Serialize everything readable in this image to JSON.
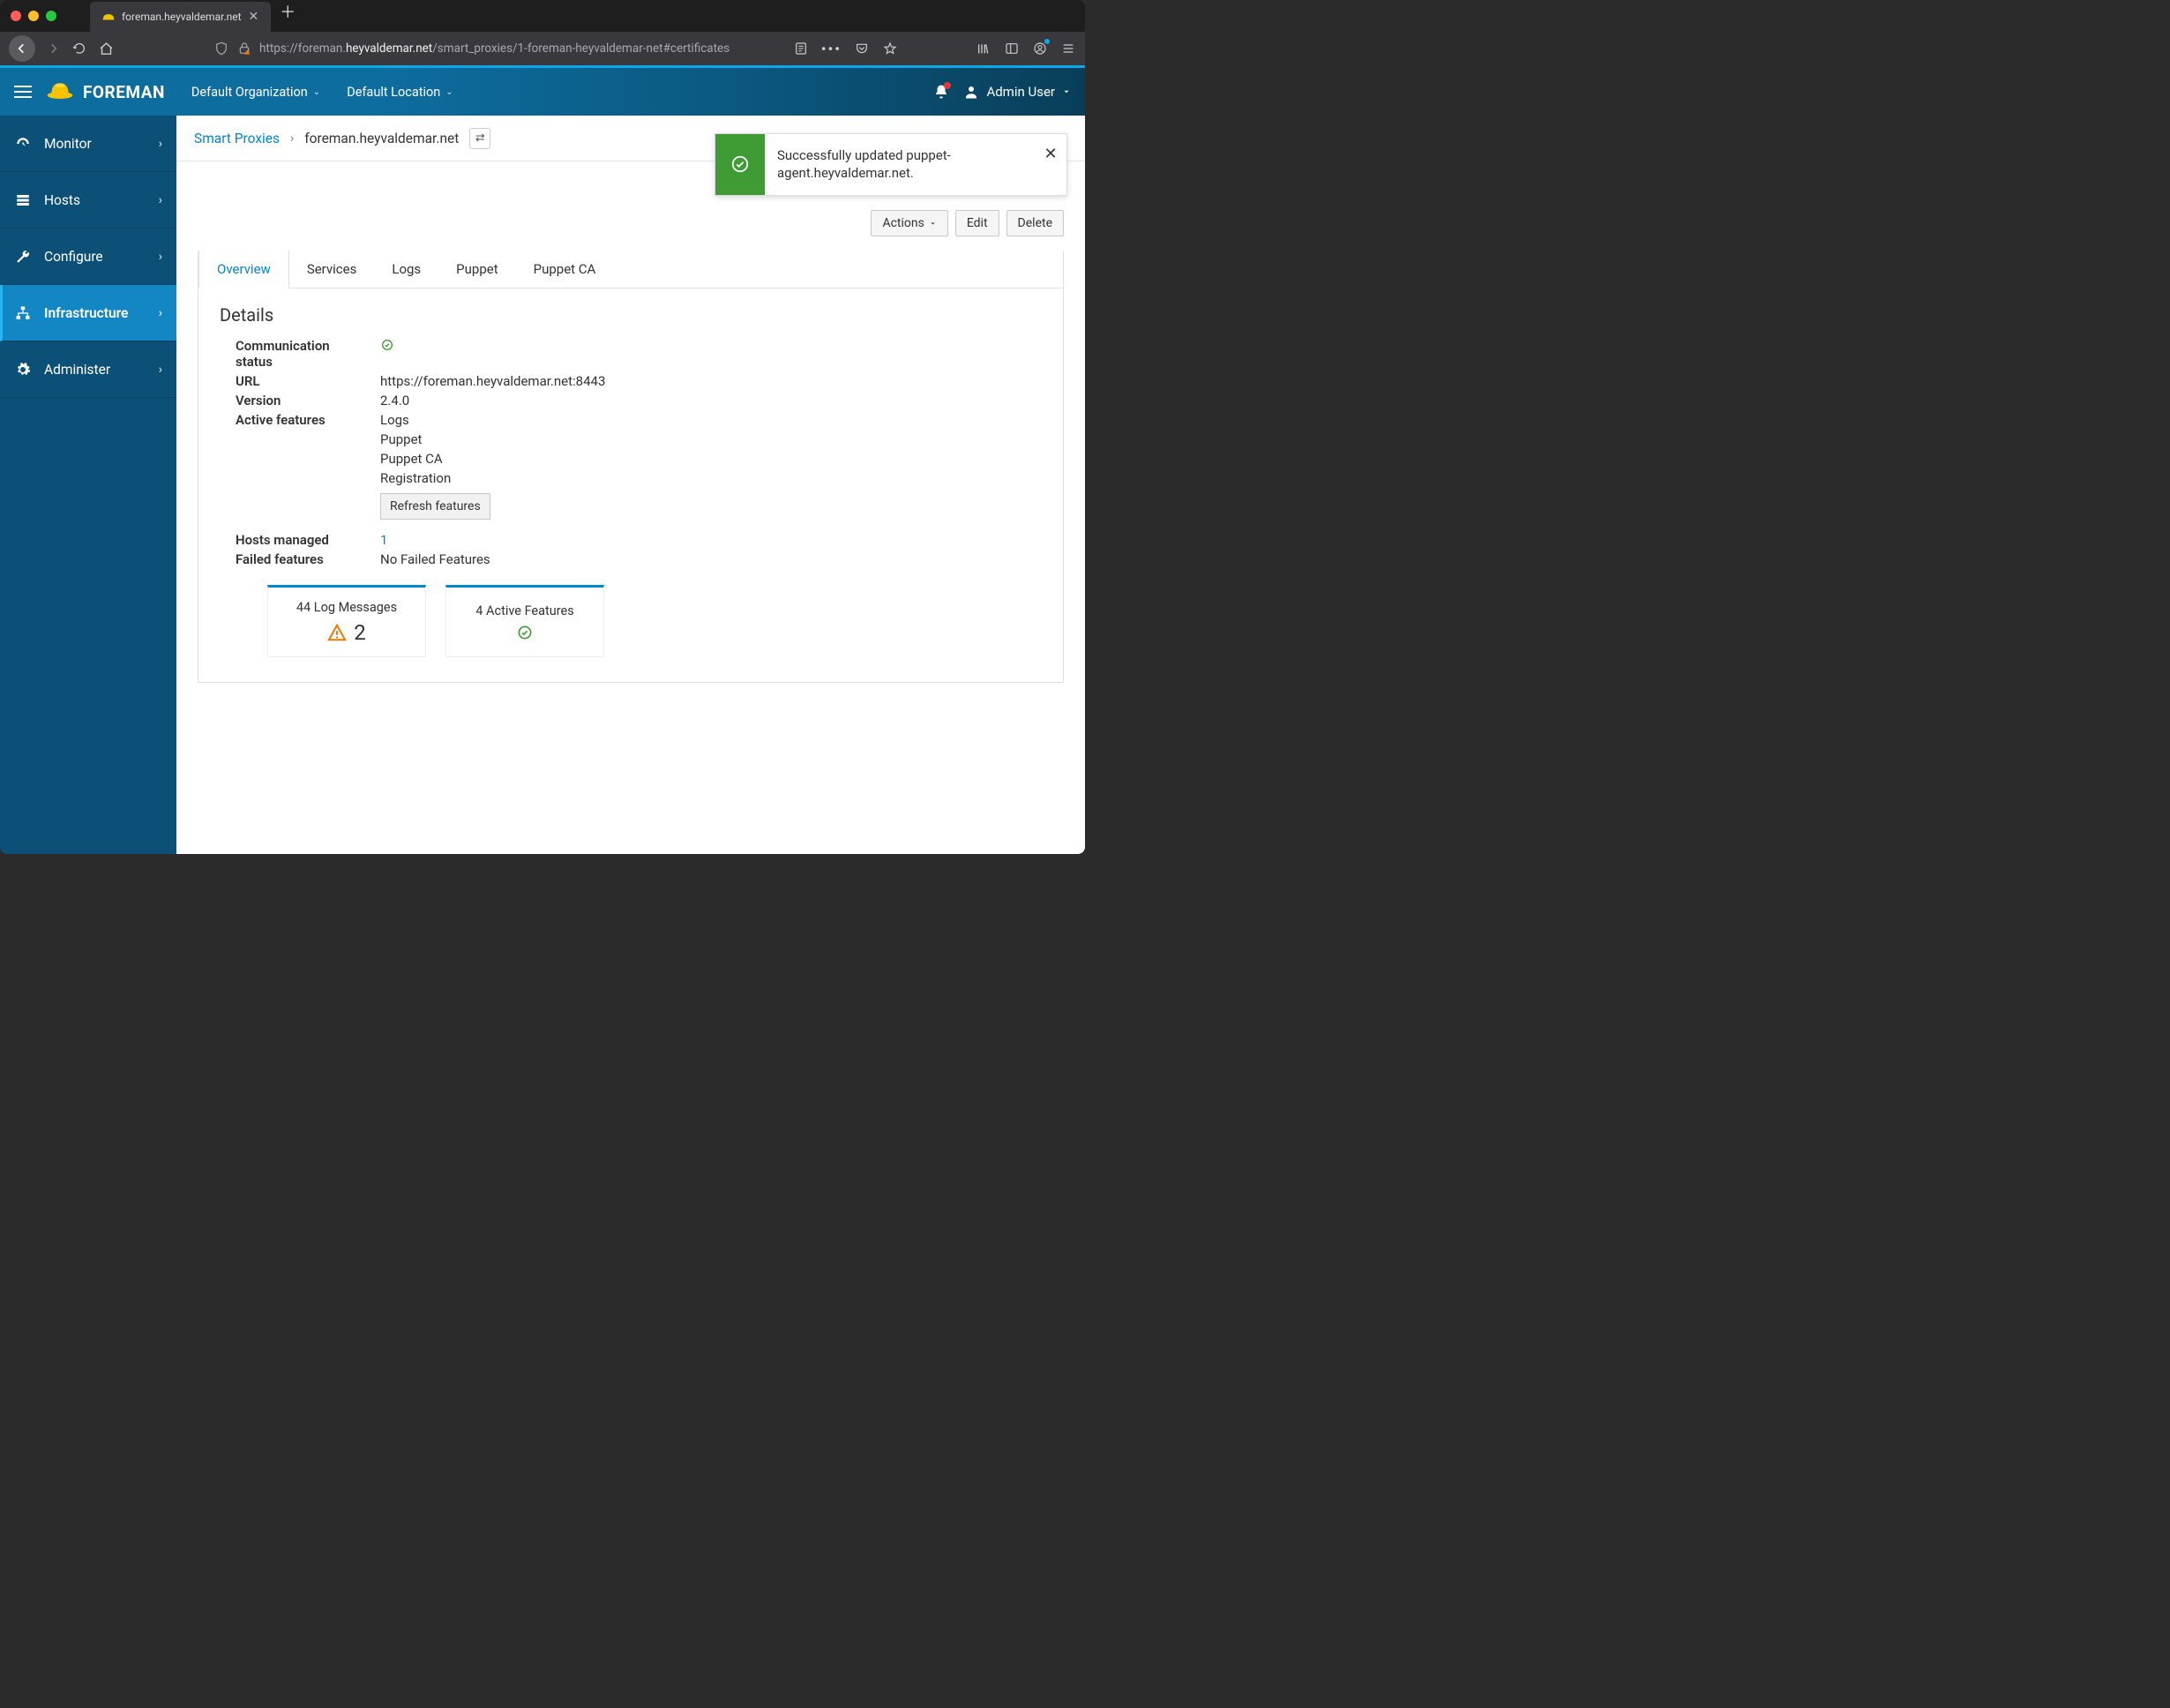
{
  "browser": {
    "tab_title": "foreman.heyvaldemar.net",
    "url_prefix": "https://foreman.",
    "url_bold": "heyvaldemar.net",
    "url_suffix": "/smart_proxies/1-foreman-heyvaldemar-net#certificates"
  },
  "header": {
    "brand": "FOREMAN",
    "organization": "Default Organization",
    "location": "Default Location",
    "user": "Admin User"
  },
  "sidebar": {
    "items": [
      {
        "label": "Monitor",
        "icon": "dashboard-icon"
      },
      {
        "label": "Hosts",
        "icon": "server-icon"
      },
      {
        "label": "Configure",
        "icon": "wrench-icon"
      },
      {
        "label": "Infrastructure",
        "icon": "network-icon",
        "active": true
      },
      {
        "label": "Administer",
        "icon": "gear-icon"
      }
    ]
  },
  "breadcrumb": {
    "root": "Smart Proxies",
    "current": "foreman.heyvaldemar.net"
  },
  "toast": {
    "message": "Successfully updated puppet-agent.heyvaldemar.net."
  },
  "actions": {
    "dropdown": "Actions",
    "edit": "Edit",
    "delete": "Delete"
  },
  "tabs": [
    {
      "label": "Overview",
      "active": true
    },
    {
      "label": "Services"
    },
    {
      "label": "Logs"
    },
    {
      "label": "Puppet"
    },
    {
      "label": "Puppet CA"
    }
  ],
  "details": {
    "heading": "Details",
    "comm_status_label": "Communication status",
    "url_label": "URL",
    "url_value": "https://foreman.heyvaldemar.net:8443",
    "version_label": "Version",
    "version_value": "2.4.0",
    "features_label": "Active features",
    "features": [
      "Logs",
      "Puppet",
      "Puppet CA",
      "Registration"
    ],
    "refresh_label": "Refresh features",
    "hosts_label": "Hosts managed",
    "hosts_value": "1",
    "failed_label": "Failed features",
    "failed_value": "No Failed Features"
  },
  "cards": {
    "log_label": "44 Log Messages",
    "log_warn_count": "2",
    "features_label": "4 Active Features"
  }
}
